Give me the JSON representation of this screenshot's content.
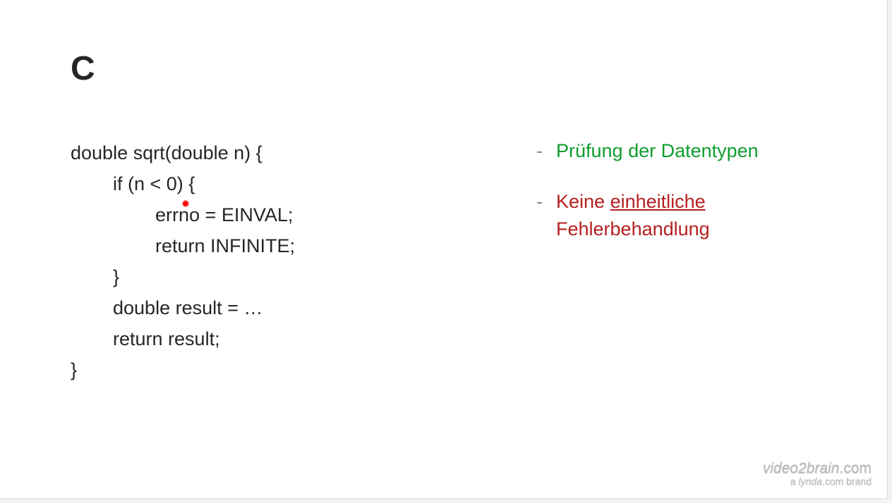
{
  "title": "C",
  "code": {
    "line1": "double sqrt(double n) {",
    "line2": "        if (n < 0) {",
    "line3": "                errno = EINVAL;",
    "line4": "                return INFINITE;",
    "line5": "        }",
    "line6": "        double result = …",
    "line7": "        return result;",
    "line8": "}"
  },
  "bullets": [
    {
      "type": "positive",
      "text_parts": [
        {
          "text": "Prüfung der Datentypen",
          "underline": false
        }
      ]
    },
    {
      "type": "negative",
      "text_parts": [
        {
          "text": "Keine ",
          "underline": false
        },
        {
          "text": "einheitliche",
          "underline": true
        },
        {
          "text": " Fehlerbehandlung",
          "underline": false
        }
      ]
    }
  ],
  "watermark": {
    "brand": "video2brain",
    "domain": ".com",
    "sub_prefix": "a ",
    "sub_brand": "lynda",
    "sub_domain": ".com",
    "sub_suffix": " brand"
  }
}
